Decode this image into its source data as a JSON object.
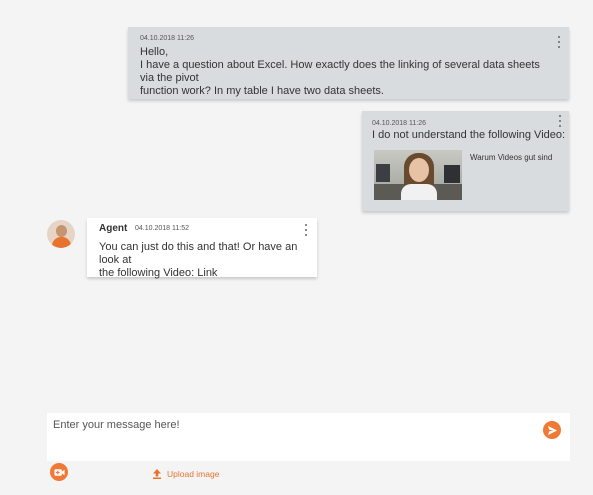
{
  "messages": [
    {
      "timestamp": "04.10.2018 11:26",
      "lines": [
        "Hello,",
        "I have a question about Excel. How exactly does the linking of several data sheets via the pivot",
        "function work? In my table I have two data sheets."
      ]
    },
    {
      "timestamp": "04.10.2018 11:26",
      "text": "I do not understand the following Video:",
      "video_title": "Warum Videos gut sind"
    },
    {
      "sender": "Agent",
      "timestamp": "04.10.2018 11:52",
      "lines": [
        "You can just do this and that! Or have an look at",
        "the following Video: Link"
      ]
    }
  ],
  "composer": {
    "placeholder": "Enter your message here!",
    "upload_label": "Upload image"
  },
  "icons": {
    "send": "send-icon",
    "video": "video-camera-icon",
    "upload": "upload-icon",
    "menu": "more-vertical-icon"
  },
  "colors": {
    "accent": "#f07a35",
    "user_bubble": "#d9dcde",
    "agent_bubble": "#ffffff",
    "background": "#f4f4f4"
  }
}
